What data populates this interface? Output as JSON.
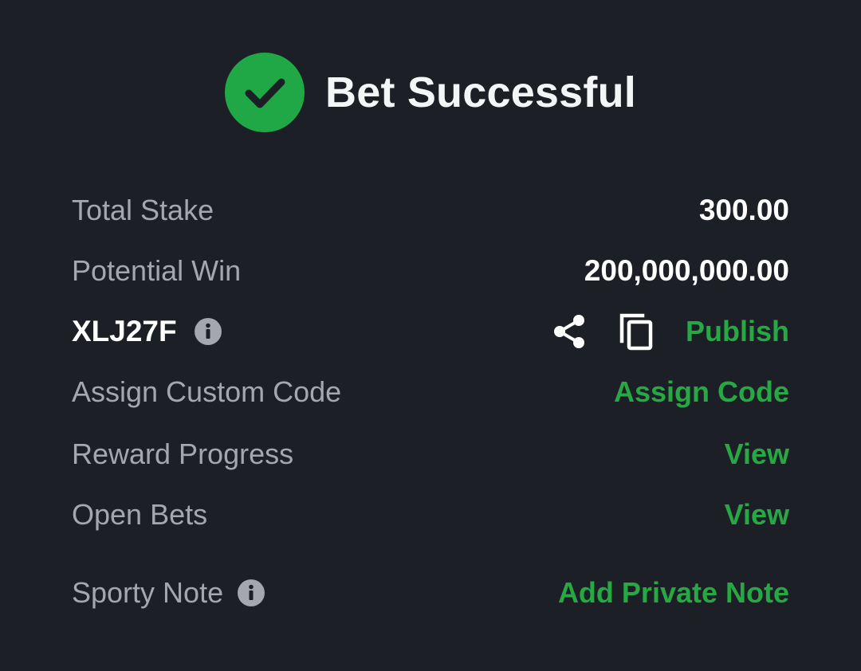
{
  "header": {
    "title": "Bet Successful"
  },
  "summary": {
    "total_stake_label": "Total Stake",
    "total_stake_value": "300.00",
    "potential_win_label": "Potential Win",
    "potential_win_value": "200,000,000.00"
  },
  "booking": {
    "code": "XLJ27F",
    "publish_label": "Publish"
  },
  "actions": {
    "assign_custom_code_label": "Assign Custom Code",
    "assign_code_link": "Assign Code",
    "reward_progress_label": "Reward Progress",
    "reward_progress_link": "View",
    "open_bets_label": "Open Bets",
    "open_bets_link": "View",
    "sporty_note_label": "Sporty Note",
    "add_private_note_link": "Add Private Note"
  },
  "colors": {
    "background": "#1c1f26",
    "accent_green": "#27a844",
    "label_gray": "#a4a7b0",
    "text_white": "#ffffff"
  },
  "icons": {
    "success": "check-circle-icon",
    "info": "info-icon",
    "share": "share-icon",
    "copy": "copy-icon"
  }
}
